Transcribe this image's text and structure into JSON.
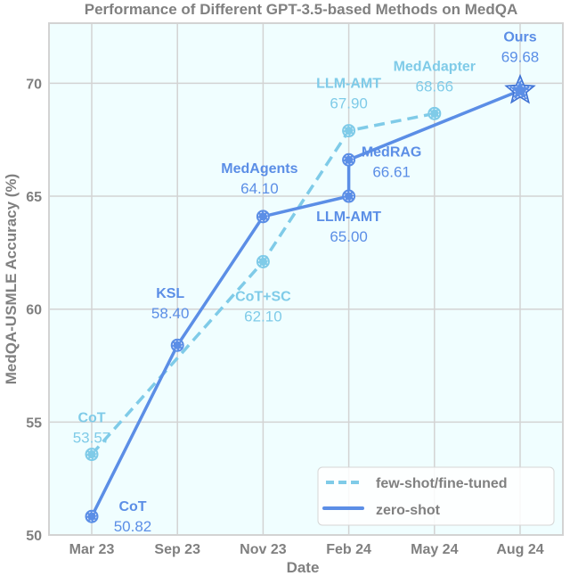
{
  "chart_data": {
    "type": "line",
    "title": "Performance of Different GPT-3.5-based Methods on MedQA",
    "xlabel": "Date",
    "ylabel": "MedQA-USMLE Accuracy (%)",
    "categories": [
      "Mar 23",
      "Sep 23",
      "Nov 23",
      "Feb 24",
      "May 24",
      "Aug 24"
    ],
    "ylim": [
      50,
      72.66
    ],
    "yticks": [
      50,
      55,
      60,
      65,
      70
    ],
    "grid": true,
    "legend_position": "bottom-right",
    "colors": {
      "few_shot": "#7fcbe8",
      "zero_shot": "#5b8ee6",
      "plot_background": "#f0feff",
      "grid": "#d3d3d3",
      "text": "#808080"
    },
    "series": [
      {
        "name": "few-shot/fine-tuned",
        "style": "dashed",
        "points": [
          {
            "x": "Mar 23",
            "y": 53.57,
            "label": "CoT"
          },
          {
            "x": "Nov 23",
            "y": 62.1,
            "label": "CoT+SC"
          },
          {
            "x": "Feb 24",
            "y": 67.9,
            "label": "LLM-AMT"
          },
          {
            "x": "May 24",
            "y": 68.66,
            "label": "MedAdapter"
          }
        ]
      },
      {
        "name": "zero-shot",
        "style": "solid",
        "points": [
          {
            "x": "Mar 23",
            "y": 50.82,
            "label": "CoT"
          },
          {
            "x": "Sep 23",
            "y": 58.4,
            "label": "KSL"
          },
          {
            "x": "Nov 23",
            "y": 64.1,
            "label": "MedAgents"
          },
          {
            "x": "Feb 24",
            "y": 65.0,
            "label": "LLM-AMT"
          },
          {
            "x": "Feb 24",
            "y": 66.61,
            "label": "MedRAG"
          },
          {
            "x": "Aug 24",
            "y": 69.68,
            "label": "Ours",
            "marker": "star"
          }
        ]
      }
    ],
    "annotations": [
      {
        "series": 0,
        "point": 0,
        "name": "CoT",
        "value": "53.57"
      },
      {
        "series": 0,
        "point": 1,
        "name": "CoT+SC",
        "value": "62.10"
      },
      {
        "series": 0,
        "point": 2,
        "name": "LLM-AMT",
        "value": "67.90"
      },
      {
        "series": 0,
        "point": 3,
        "name": "MedAdapter",
        "value": "68.66"
      },
      {
        "series": 1,
        "point": 0,
        "name": "CoT",
        "value": "50.82"
      },
      {
        "series": 1,
        "point": 1,
        "name": "KSL",
        "value": "58.40"
      },
      {
        "series": 1,
        "point": 2,
        "name": "MedAgents",
        "value": "64.10"
      },
      {
        "series": 1,
        "point": 3,
        "name": "LLM-AMT",
        "value": "65.00"
      },
      {
        "series": 1,
        "point": 4,
        "name": "MedRAG",
        "value": "66.61"
      },
      {
        "series": 1,
        "point": 5,
        "name": "Ours",
        "value": "69.68"
      }
    ]
  }
}
